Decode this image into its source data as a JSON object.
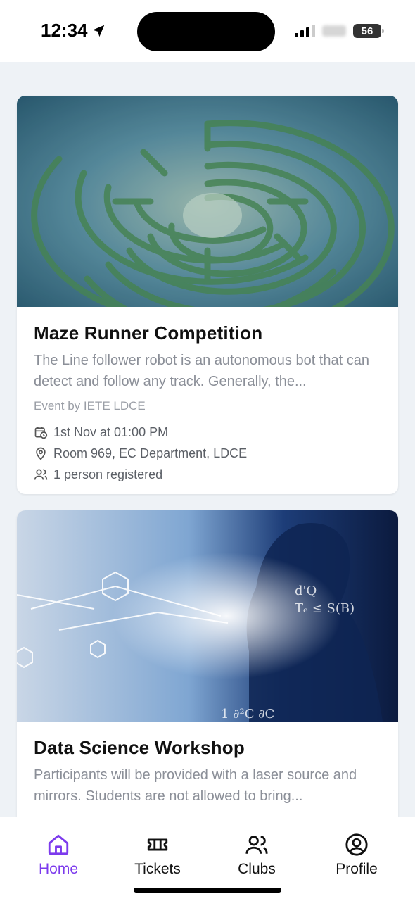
{
  "status_bar": {
    "time": "12:34",
    "battery": "56"
  },
  "events": [
    {
      "title": "Maze Runner Competition",
      "description": "The Line follower robot is an autonomous bot that can detect and follow any track. Generally, the...",
      "organizer": "Event by IETE LDCE",
      "datetime": "1st Nov at 01:00 PM",
      "location": "Room 969, EC Department, LDCE",
      "registrations": "1 person registered",
      "image": "maze-hedge-photo"
    },
    {
      "title": "Data Science Workshop",
      "description": "Participants will be provided with a laser source and mirrors. Students are not allowed to bring...",
      "image": "data-science-photo"
    }
  ],
  "tabs": [
    {
      "label": "Home",
      "icon": "home-icon",
      "active": true
    },
    {
      "label": "Tickets",
      "icon": "ticket-icon",
      "active": false
    },
    {
      "label": "Clubs",
      "icon": "users-icon",
      "active": false
    },
    {
      "label": "Profile",
      "icon": "user-circle-icon",
      "active": false
    }
  ],
  "colors": {
    "accent": "#7c3aed",
    "background": "#eef2f6"
  }
}
